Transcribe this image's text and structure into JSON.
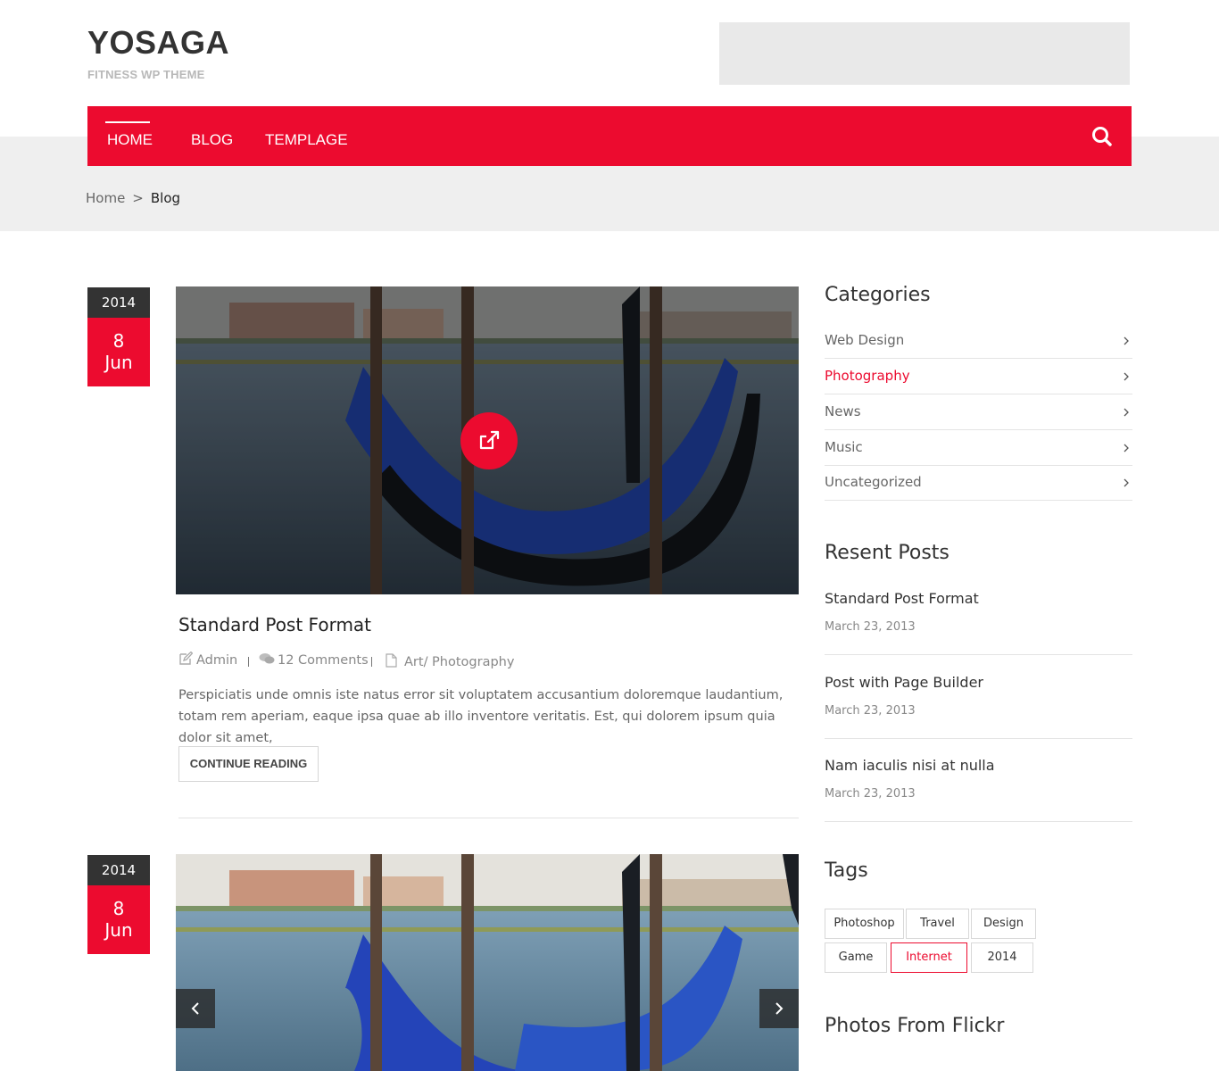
{
  "site": {
    "title": "YOSAGA",
    "tagline": "FITNESS WP THEME"
  },
  "nav": {
    "items": [
      {
        "label": "HOME"
      },
      {
        "label": "BLOG"
      },
      {
        "label": "TEMPLAGE"
      }
    ],
    "active_item": "HOME",
    "search_icon": "search-icon"
  },
  "breadcrumb": {
    "home": "Home",
    "separator": ">",
    "current": "Blog"
  },
  "posts": [
    {
      "year": "2014",
      "day": "8",
      "month": "Jun",
      "title": "Standard Post Format",
      "author": "Admin",
      "comments": "12 Comments",
      "categories": "Art/ Photography",
      "excerpt": "Perspiciatis unde omnis iste natus error sit voluptatem accusantium doloremque laudantium, totam rem aperiam, eaque ipsa quae ab illo inventore veritatis. Est, qui dolorem ipsum quia dolor sit amet,",
      "button": "CONTINUE READING"
    },
    {
      "year": "2014",
      "day": "8",
      "month": "Jun"
    }
  ],
  "sidebar": {
    "categories": {
      "title": "Categories",
      "items": [
        {
          "label": "Web Design"
        },
        {
          "label": "Photography"
        },
        {
          "label": "News"
        },
        {
          "label": "Music"
        },
        {
          "label": "Uncategorized"
        }
      ],
      "highlighted": "Photography"
    },
    "recent_posts": {
      "title": "Resent Posts",
      "items": [
        {
          "title": "Standard Post Format",
          "date": "March 23, 2013"
        },
        {
          "title": "Post with Page Builder",
          "date": "March 23, 2013"
        },
        {
          "title": "Nam iaculis nisi at nulla",
          "date": "March 23, 2013"
        }
      ]
    },
    "tags": {
      "title": "Tags",
      "items": [
        {
          "label": "Photoshop"
        },
        {
          "label": "Travel"
        },
        {
          "label": "Design"
        },
        {
          "label": "Game"
        },
        {
          "label": "Internet"
        },
        {
          "label": "2014"
        }
      ],
      "highlighted": "Internet"
    },
    "flickr": {
      "title": "Photos From Flickr"
    }
  },
  "colors": {
    "accent": "#ec0b2f",
    "dark": "#333333",
    "band": "#efefef"
  }
}
